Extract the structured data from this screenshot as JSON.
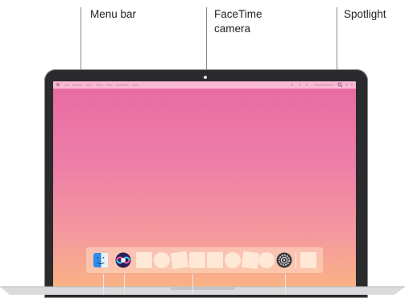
{
  "labels": {
    "menu_bar": "Menu bar",
    "facetime_camera_line1": "FaceTime",
    "facetime_camera_line2": "camera",
    "spotlight": "Spotlight"
  },
  "icons": {
    "finder": "finder-icon",
    "siri": "siri-icon",
    "system_preferences": "gear-icon",
    "spotlight": "search-icon"
  },
  "colors": {
    "wallpaper_top": "#e86aa2",
    "wallpaper_bottom": "#fbb67f",
    "laptop_bezel": "#2b2b2d",
    "callout_line": "#8a8a8a"
  }
}
